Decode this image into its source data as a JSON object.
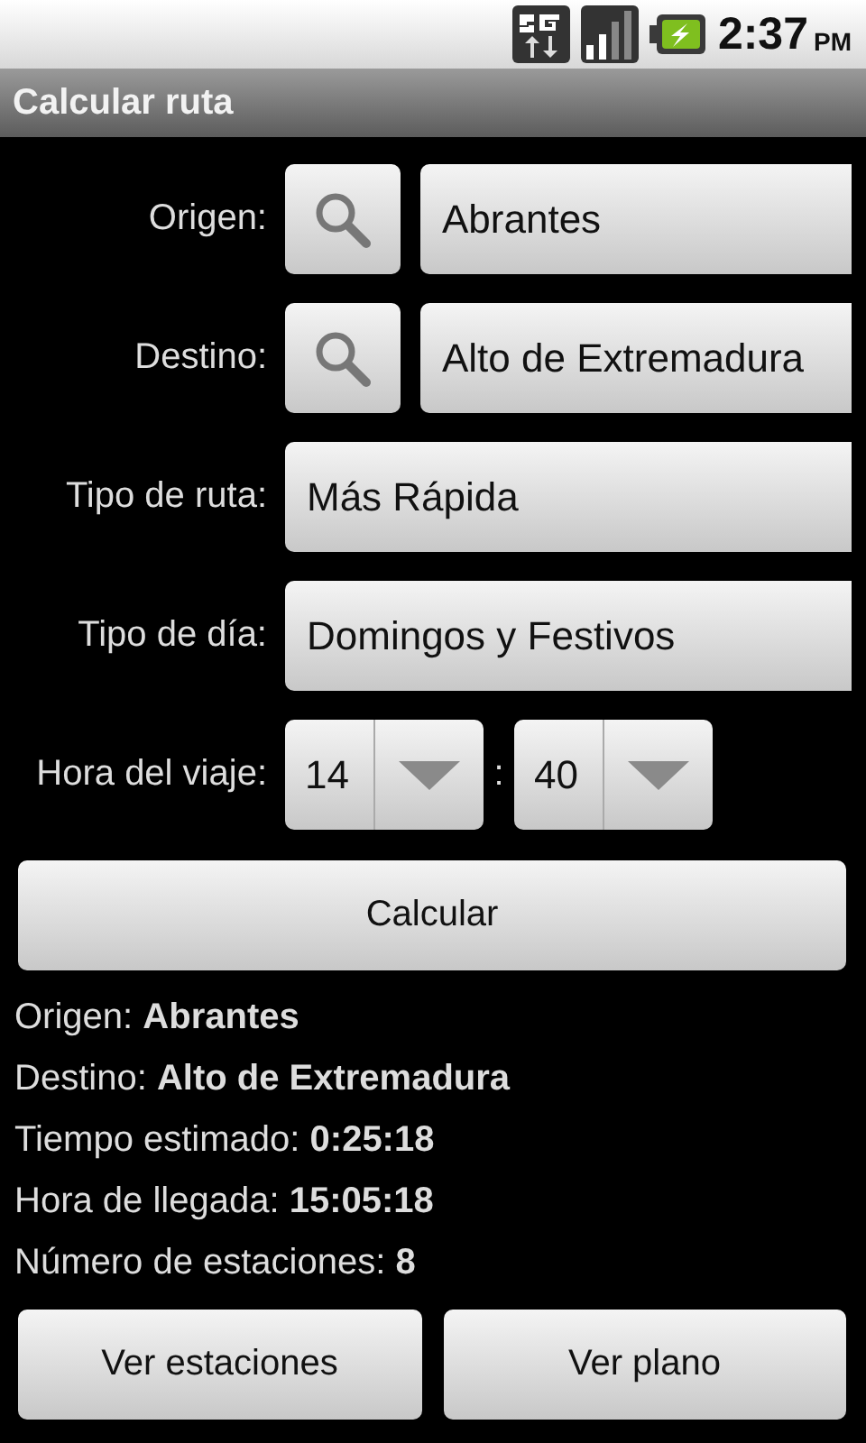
{
  "status_bar": {
    "time": "2:37",
    "ampm": "PM"
  },
  "title": "Calcular ruta",
  "form": [
    {
      "kind": "search",
      "label": "Origen:",
      "value": "Abrantes"
    },
    {
      "kind": "search",
      "label": "Destino:",
      "value": "Alto de Extremadura"
    },
    {
      "kind": "select",
      "label": "Tipo de ruta:",
      "value": "Más Rápida"
    },
    {
      "kind": "select",
      "label": "Tipo de día:",
      "value": "Domingos y Festivos"
    },
    {
      "kind": "time",
      "label": "Hora del viaje:",
      "hour": "14",
      "separator": ":",
      "minute": "40"
    }
  ],
  "calculate_button": "Calcular",
  "results": [
    "Origen: **Abrantes**",
    "Destino: **Alto de Extremadura**",
    "Tiempo estimado: **0:25:18**",
    "Hora de llegada: **15:05:18**",
    "Número de estaciones: **8**"
  ],
  "buttons": [
    "Ver estaciones",
    "Ver plano"
  ]
}
